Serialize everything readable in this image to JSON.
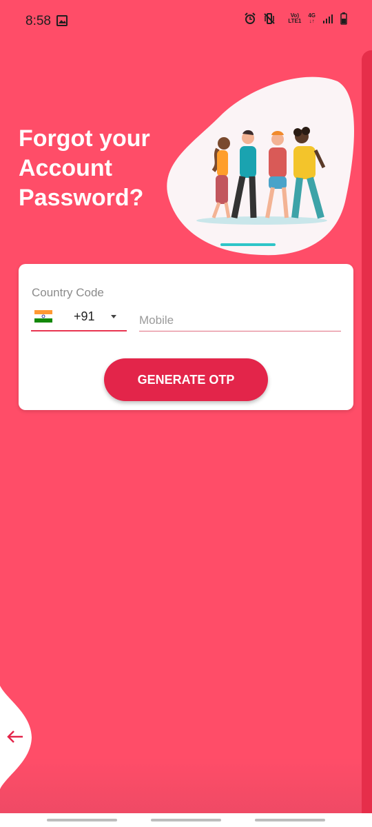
{
  "status_bar": {
    "time": "8:58",
    "network_top": "Vo)",
    "network_bottom": "LTE1",
    "net_4g": "4G"
  },
  "header": {
    "title": "Forgot your Account Password?"
  },
  "form": {
    "country_code_label": "Country Code",
    "country_code_value": "+91",
    "mobile_placeholder": "Mobile",
    "generate_button": "GENERATE OTP"
  },
  "colors": {
    "background": "#ff4d68",
    "accent": "#e3254a",
    "card": "#ffffff"
  },
  "icons": {
    "back": "arrow-left-icon",
    "flag": "india-flag-icon"
  }
}
